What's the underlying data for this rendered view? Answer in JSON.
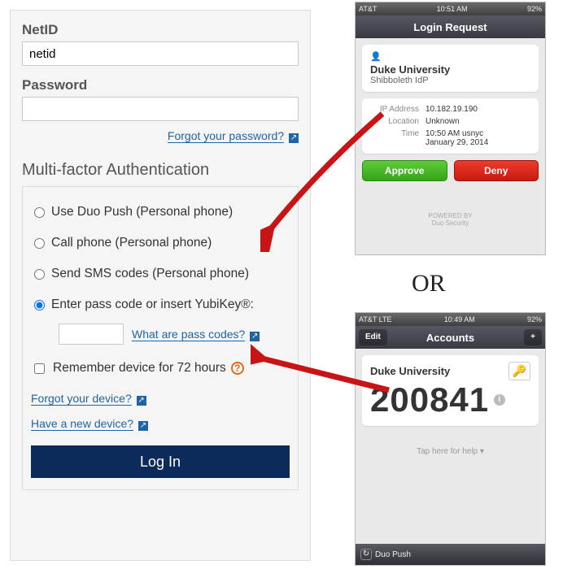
{
  "login": {
    "netid_label": "NetID",
    "netid_value": "netid",
    "password_label": "Password",
    "password_value": "",
    "forgot_password": "Forgot your password?",
    "mfa_heading": "Multi-factor Authentication",
    "options": {
      "duo_push": "Use Duo Push (Personal phone)",
      "call": "Call phone (Personal phone)",
      "sms": "Send SMS codes (Personal phone)",
      "passcode": "Enter pass code or insert YubiKey®:"
    },
    "selected": "passcode",
    "passcode_link": "What are pass codes?",
    "remember_label": "Remember device for 72 hours",
    "forgot_device": "Forgot your device?",
    "new_device": "Have a new device?",
    "login_button": "Log In"
  },
  "or_label": "OR",
  "phone1": {
    "carrier": "AT&T",
    "time": "10:51 AM",
    "battery": "92%",
    "title": "Login Request",
    "org": "Duke University",
    "sub": "Shibboleth IdP",
    "ip_label": "IP Address",
    "ip": "10.182.19.190",
    "loc_label": "Location",
    "loc": "Unknown",
    "time_label": "Time",
    "time_val1": "10:50 AM usnyc",
    "time_val2": "January 29, 2014",
    "approve": "Approve",
    "deny": "Deny",
    "footer1": "POWERED BY",
    "footer2": "Duo Security"
  },
  "phone2": {
    "carrier": "AT&T  LTE",
    "time": "10:49 AM",
    "battery": "92%",
    "edit": "Edit",
    "title": "Accounts",
    "plus": "+",
    "org": "Duke University",
    "code": "200841",
    "tap_help": "Tap here for help ▾",
    "duo_push": "Duo Push"
  }
}
